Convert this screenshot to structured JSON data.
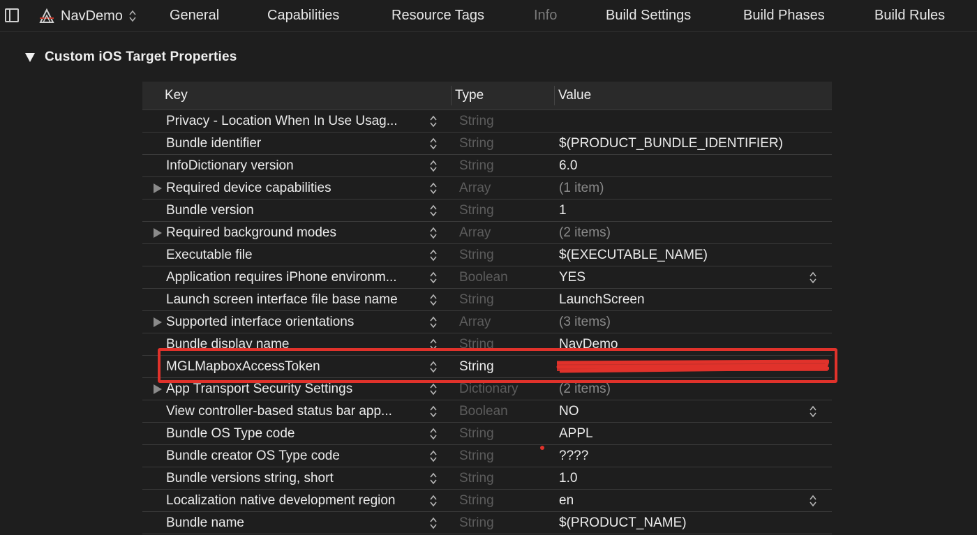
{
  "target": {
    "name": "NavDemo"
  },
  "tabs": [
    {
      "label": "General",
      "active": false
    },
    {
      "label": "Capabilities",
      "active": false
    },
    {
      "label": "Resource Tags",
      "active": false
    },
    {
      "label": "Info",
      "active": true
    },
    {
      "label": "Build Settings",
      "active": false
    },
    {
      "label": "Build Phases",
      "active": false
    },
    {
      "label": "Build Rules",
      "active": false
    }
  ],
  "section": {
    "title": "Custom iOS Target Properties"
  },
  "table": {
    "headers": {
      "key": "Key",
      "type": "Type",
      "value": "Value"
    },
    "rows": [
      {
        "key": "Privacy - Location When In Use Usag...",
        "type": "String",
        "value": "",
        "expandable": false
      },
      {
        "key": "Bundle identifier",
        "type": "String",
        "value": "$(PRODUCT_BUNDLE_IDENTIFIER)",
        "expandable": false
      },
      {
        "key": "InfoDictionary version",
        "type": "String",
        "value": "6.0",
        "expandable": false
      },
      {
        "key": "Required device capabilities",
        "type": "Array",
        "value": "(1 item)",
        "expandable": true
      },
      {
        "key": "Bundle version",
        "type": "String",
        "value": "1",
        "expandable": false
      },
      {
        "key": "Required background modes",
        "type": "Array",
        "value": "(2 items)",
        "expandable": true
      },
      {
        "key": "Executable file",
        "type": "String",
        "value": "$(EXECUTABLE_NAME)",
        "expandable": false
      },
      {
        "key": "Application requires iPhone environm...",
        "type": "Boolean",
        "value": "YES",
        "expandable": false,
        "value_stepper": true
      },
      {
        "key": "Launch screen interface file base name",
        "type": "String",
        "value": "LaunchScreen",
        "expandable": false
      },
      {
        "key": "Supported interface orientations",
        "type": "Array",
        "value": "(3 items)",
        "expandable": true
      },
      {
        "key": "Bundle display name",
        "type": "String",
        "value": "NavDemo",
        "expandable": false
      },
      {
        "key": "MGLMapboxAccessToken",
        "type": "String",
        "value": "",
        "expandable": false,
        "selected": true,
        "redacted": true
      },
      {
        "key": "App Transport Security Settings",
        "type": "Dictionary",
        "value": "(2 items)",
        "expandable": true
      },
      {
        "key": "View controller-based status bar app...",
        "type": "Boolean",
        "value": "NO",
        "expandable": false,
        "value_stepper": true
      },
      {
        "key": "Bundle OS Type code",
        "type": "String",
        "value": "APPL",
        "expandable": false
      },
      {
        "key": "Bundle creator OS Type code",
        "type": "String",
        "value": "????",
        "expandable": false
      },
      {
        "key": "Bundle versions string, short",
        "type": "String",
        "value": "1.0",
        "expandable": false
      },
      {
        "key": "Localization native development region",
        "type": "String",
        "value": "en",
        "expandable": false,
        "value_stepper": true
      },
      {
        "key": "Bundle name",
        "type": "String",
        "value": "$(PRODUCT_NAME)",
        "expandable": false
      }
    ]
  },
  "colors": {
    "annotation_red": "#e0322b",
    "background": "#1e1e1e"
  }
}
